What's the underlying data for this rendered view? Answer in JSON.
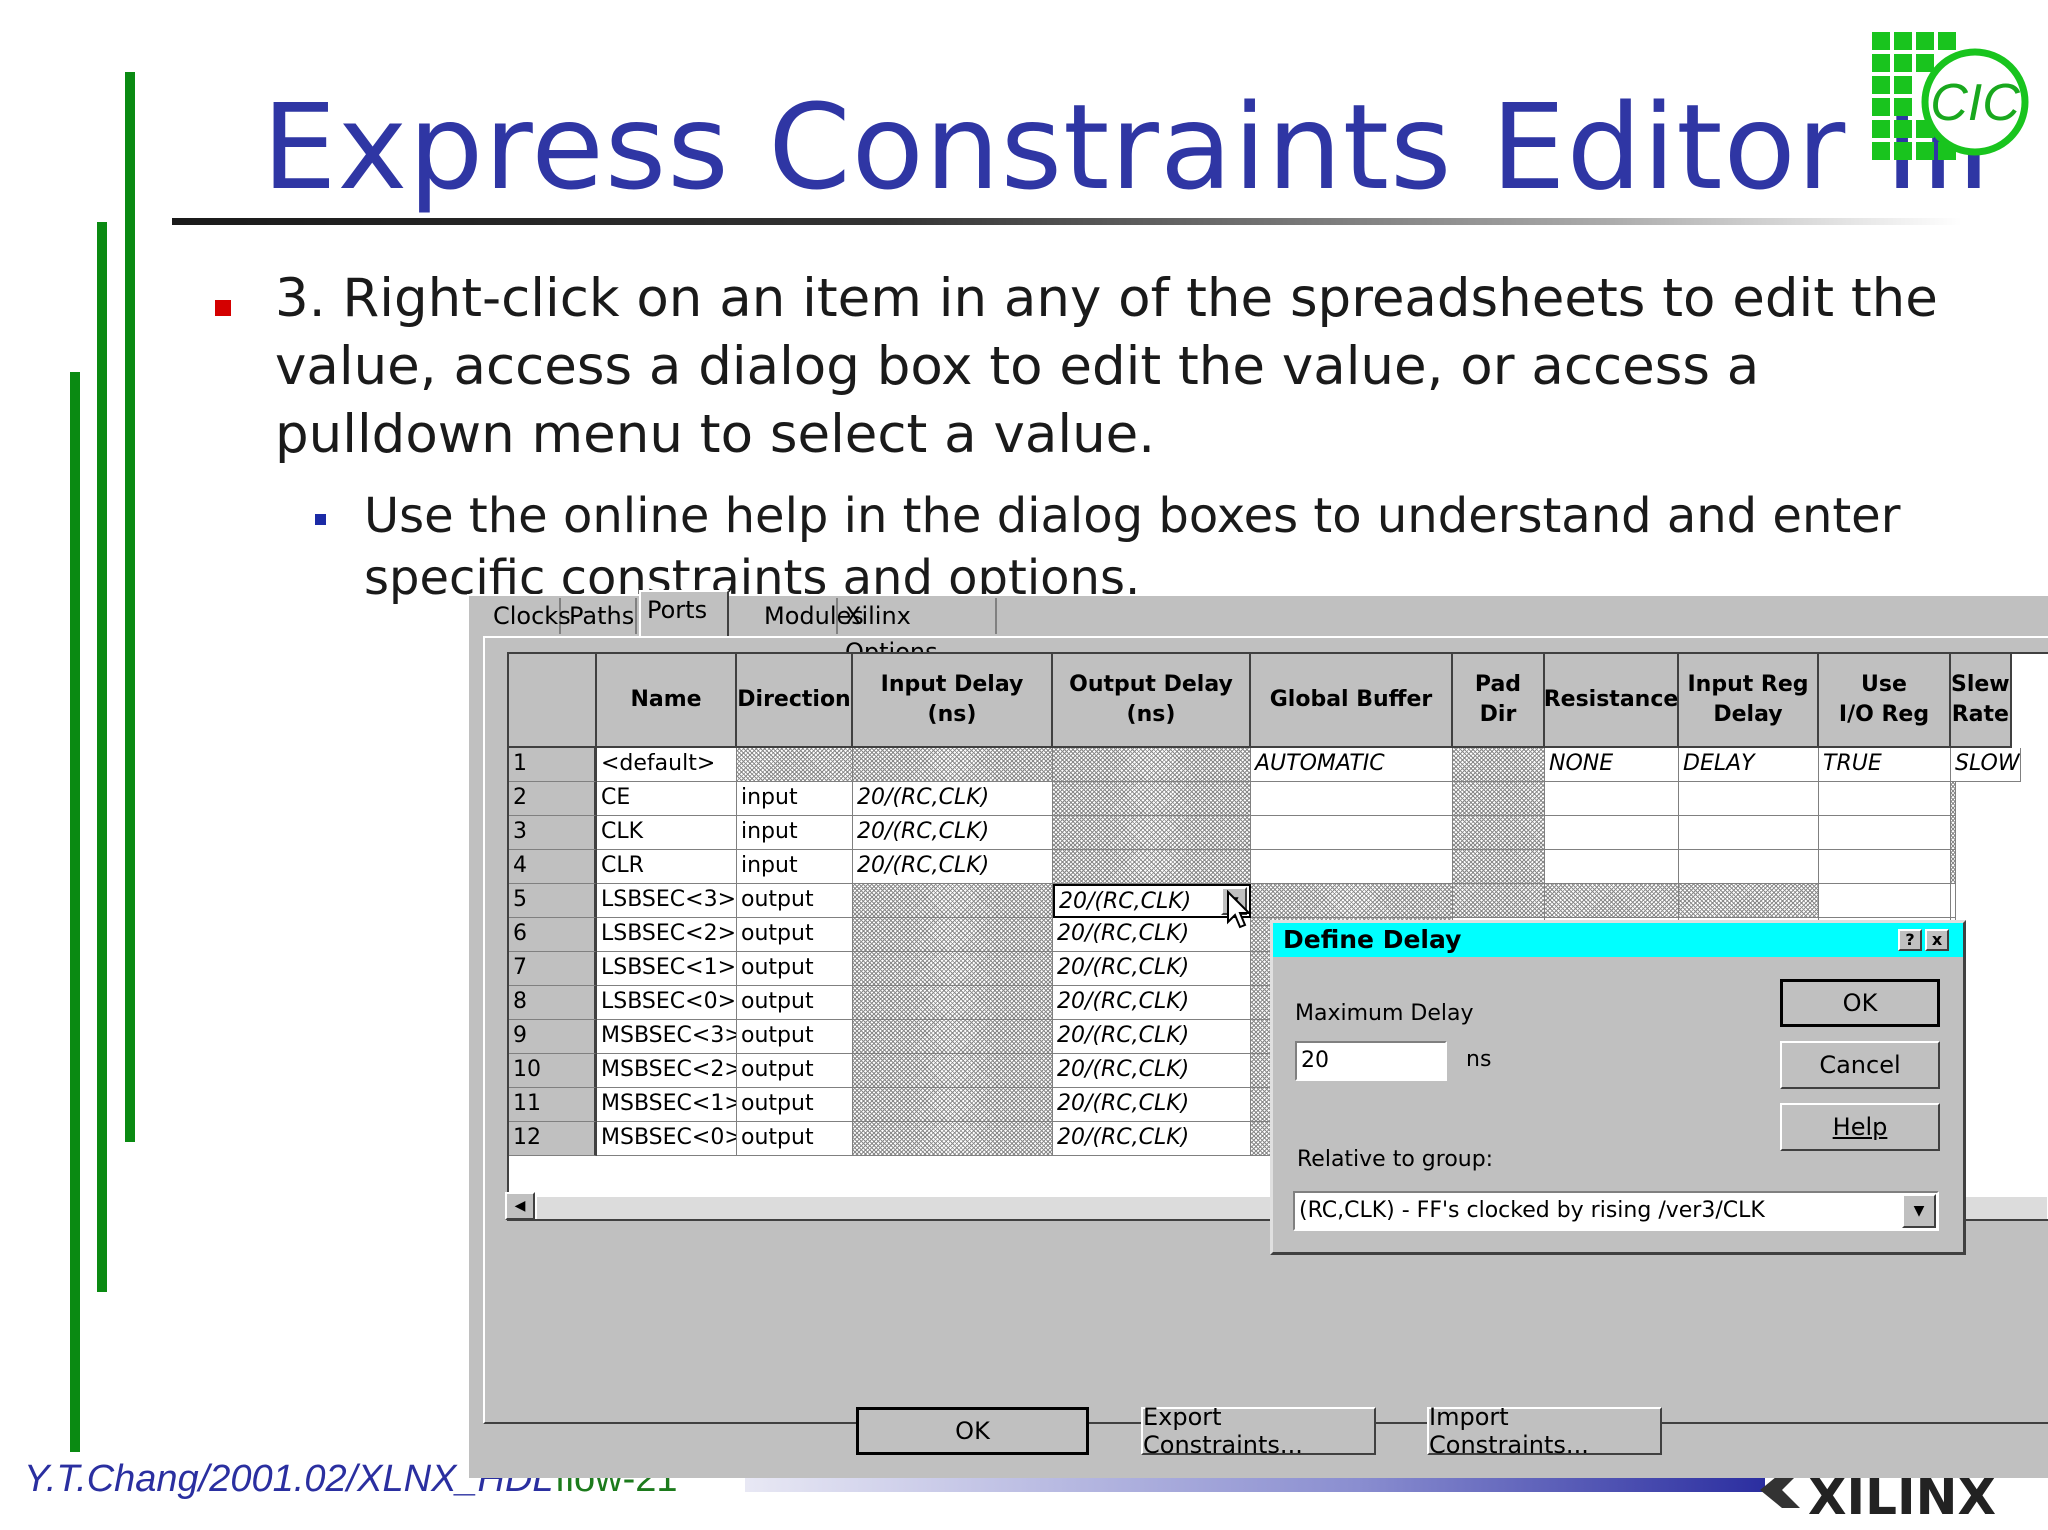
{
  "slide": {
    "title": "Express Constraints Editor III",
    "bullet1": "3. Right-click on an item in any of the spreadsheets to edit the value, access a dialog box to edit the value, or access a pulldown menu to select a value.",
    "bullet2": "Use the online help in the dialog boxes to understand and enter specific constraints and options.",
    "logo_text": "CIC",
    "footer_left": "Y.T.Chang/2001.02/XLNX_HDL",
    "footer_page": "flow-21",
    "footer_brand": "XILINX",
    "colors": {
      "title": "#2f36a4",
      "accent_green": "#0a8a12",
      "bullet_red": "#d40000",
      "dialog_title": "#00ffff"
    }
  },
  "window": {
    "tabs": [
      {
        "label": "Clocks",
        "active": false
      },
      {
        "label": "Paths",
        "active": false
      },
      {
        "label": "Ports",
        "active": true
      },
      {
        "label": "Modules",
        "active": false
      },
      {
        "label": "Xilinx Options",
        "active": false
      }
    ],
    "columns": [
      "Name",
      "Direction",
      "Input Delay\n(ns)",
      "Output Delay\n(ns)",
      "Global Buffer",
      "Pad\nDir",
      "Resistance",
      "Input Reg\nDelay",
      "Use\nI/O Reg",
      "Slew\nRate"
    ],
    "rows": [
      {
        "num": "1",
        "name": "<default>",
        "direction": "",
        "input_delay": "",
        "output_delay": "",
        "global_buffer": "AUTOMATIC",
        "pad_dir": "",
        "resistance": "NONE",
        "input_reg_delay": "DELAY",
        "use_io_reg": "TRUE",
        "slew_rate": "SLOW"
      },
      {
        "num": "2",
        "name": "CE",
        "direction": "input",
        "input_delay": "20/(RC,CLK)",
        "output_delay": "",
        "global_buffer": "",
        "pad_dir": "",
        "resistance": "",
        "input_reg_delay": "",
        "use_io_reg": "",
        "slew_rate": ""
      },
      {
        "num": "3",
        "name": "CLK",
        "direction": "input",
        "input_delay": "20/(RC,CLK)",
        "output_delay": "",
        "global_buffer": "",
        "pad_dir": "",
        "resistance": "",
        "input_reg_delay": "",
        "use_io_reg": "",
        "slew_rate": ""
      },
      {
        "num": "4",
        "name": "CLR",
        "direction": "input",
        "input_delay": "20/(RC,CLK)",
        "output_delay": "",
        "global_buffer": "",
        "pad_dir": "",
        "resistance": "",
        "input_reg_delay": "",
        "use_io_reg": "",
        "slew_rate": ""
      },
      {
        "num": "5",
        "name": "LSBSEC<3>",
        "direction": "output",
        "input_delay": "",
        "output_delay": "20/(RC,CLK)",
        "global_buffer": "",
        "pad_dir": "",
        "resistance": "",
        "input_reg_delay": "",
        "use_io_reg": "",
        "slew_rate": ""
      },
      {
        "num": "6",
        "name": "LSBSEC<2>",
        "direction": "output",
        "input_delay": "",
        "output_delay": "20/(RC,CLK)",
        "global_buffer": "",
        "pad_dir": "",
        "resistance": "",
        "input_reg_delay": "",
        "use_io_reg": "",
        "slew_rate": ""
      },
      {
        "num": "7",
        "name": "LSBSEC<1>",
        "direction": "output",
        "input_delay": "",
        "output_delay": "20/(RC,CLK)",
        "global_buffer": "",
        "pad_dir": "",
        "resistance": "",
        "input_reg_delay": "",
        "use_io_reg": "",
        "slew_rate": ""
      },
      {
        "num": "8",
        "name": "LSBSEC<0>",
        "direction": "output",
        "input_delay": "",
        "output_delay": "20/(RC,CLK)",
        "global_buffer": "",
        "pad_dir": "",
        "resistance": "",
        "input_reg_delay": "",
        "use_io_reg": "",
        "slew_rate": ""
      },
      {
        "num": "9",
        "name": "MSBSEC<3>",
        "direction": "output",
        "input_delay": "",
        "output_delay": "20/(RC,CLK)",
        "global_buffer": "",
        "pad_dir": "",
        "resistance": "",
        "input_reg_delay": "",
        "use_io_reg": "",
        "slew_rate": ""
      },
      {
        "num": "10",
        "name": "MSBSEC<2>",
        "direction": "output",
        "input_delay": "",
        "output_delay": "20/(RC,CLK)",
        "global_buffer": "",
        "pad_dir": "",
        "resistance": "",
        "input_reg_delay": "",
        "use_io_reg": "",
        "slew_rate": ""
      },
      {
        "num": "11",
        "name": "MSBSEC<1>",
        "direction": "output",
        "input_delay": "",
        "output_delay": "20/(RC,CLK)",
        "global_buffer": "",
        "pad_dir": "",
        "resistance": "",
        "input_reg_delay": "",
        "use_io_reg": "",
        "slew_rate": ""
      },
      {
        "num": "12",
        "name": "MSBSEC<0>",
        "direction": "output",
        "input_delay": "",
        "output_delay": "20/(RC,CLK)",
        "global_buffer": "",
        "pad_dir": "",
        "resistance": "",
        "input_reg_delay": "",
        "use_io_reg": "",
        "slew_rate": ""
      }
    ],
    "buttons": {
      "ok": "OK",
      "export": "Export Constraints...",
      "import": "Import Constraints..."
    }
  },
  "dialog": {
    "title": "Define Delay",
    "title_help": "?",
    "title_close": "x",
    "max_delay_label": "Maximum Delay",
    "max_delay_value": "20",
    "unit": "ns",
    "relative_label": "Relative to group:",
    "relative_value": "(RC,CLK) - FF's clocked by rising /ver3/CLK",
    "ok": "OK",
    "cancel": "Cancel",
    "help": "Help"
  }
}
